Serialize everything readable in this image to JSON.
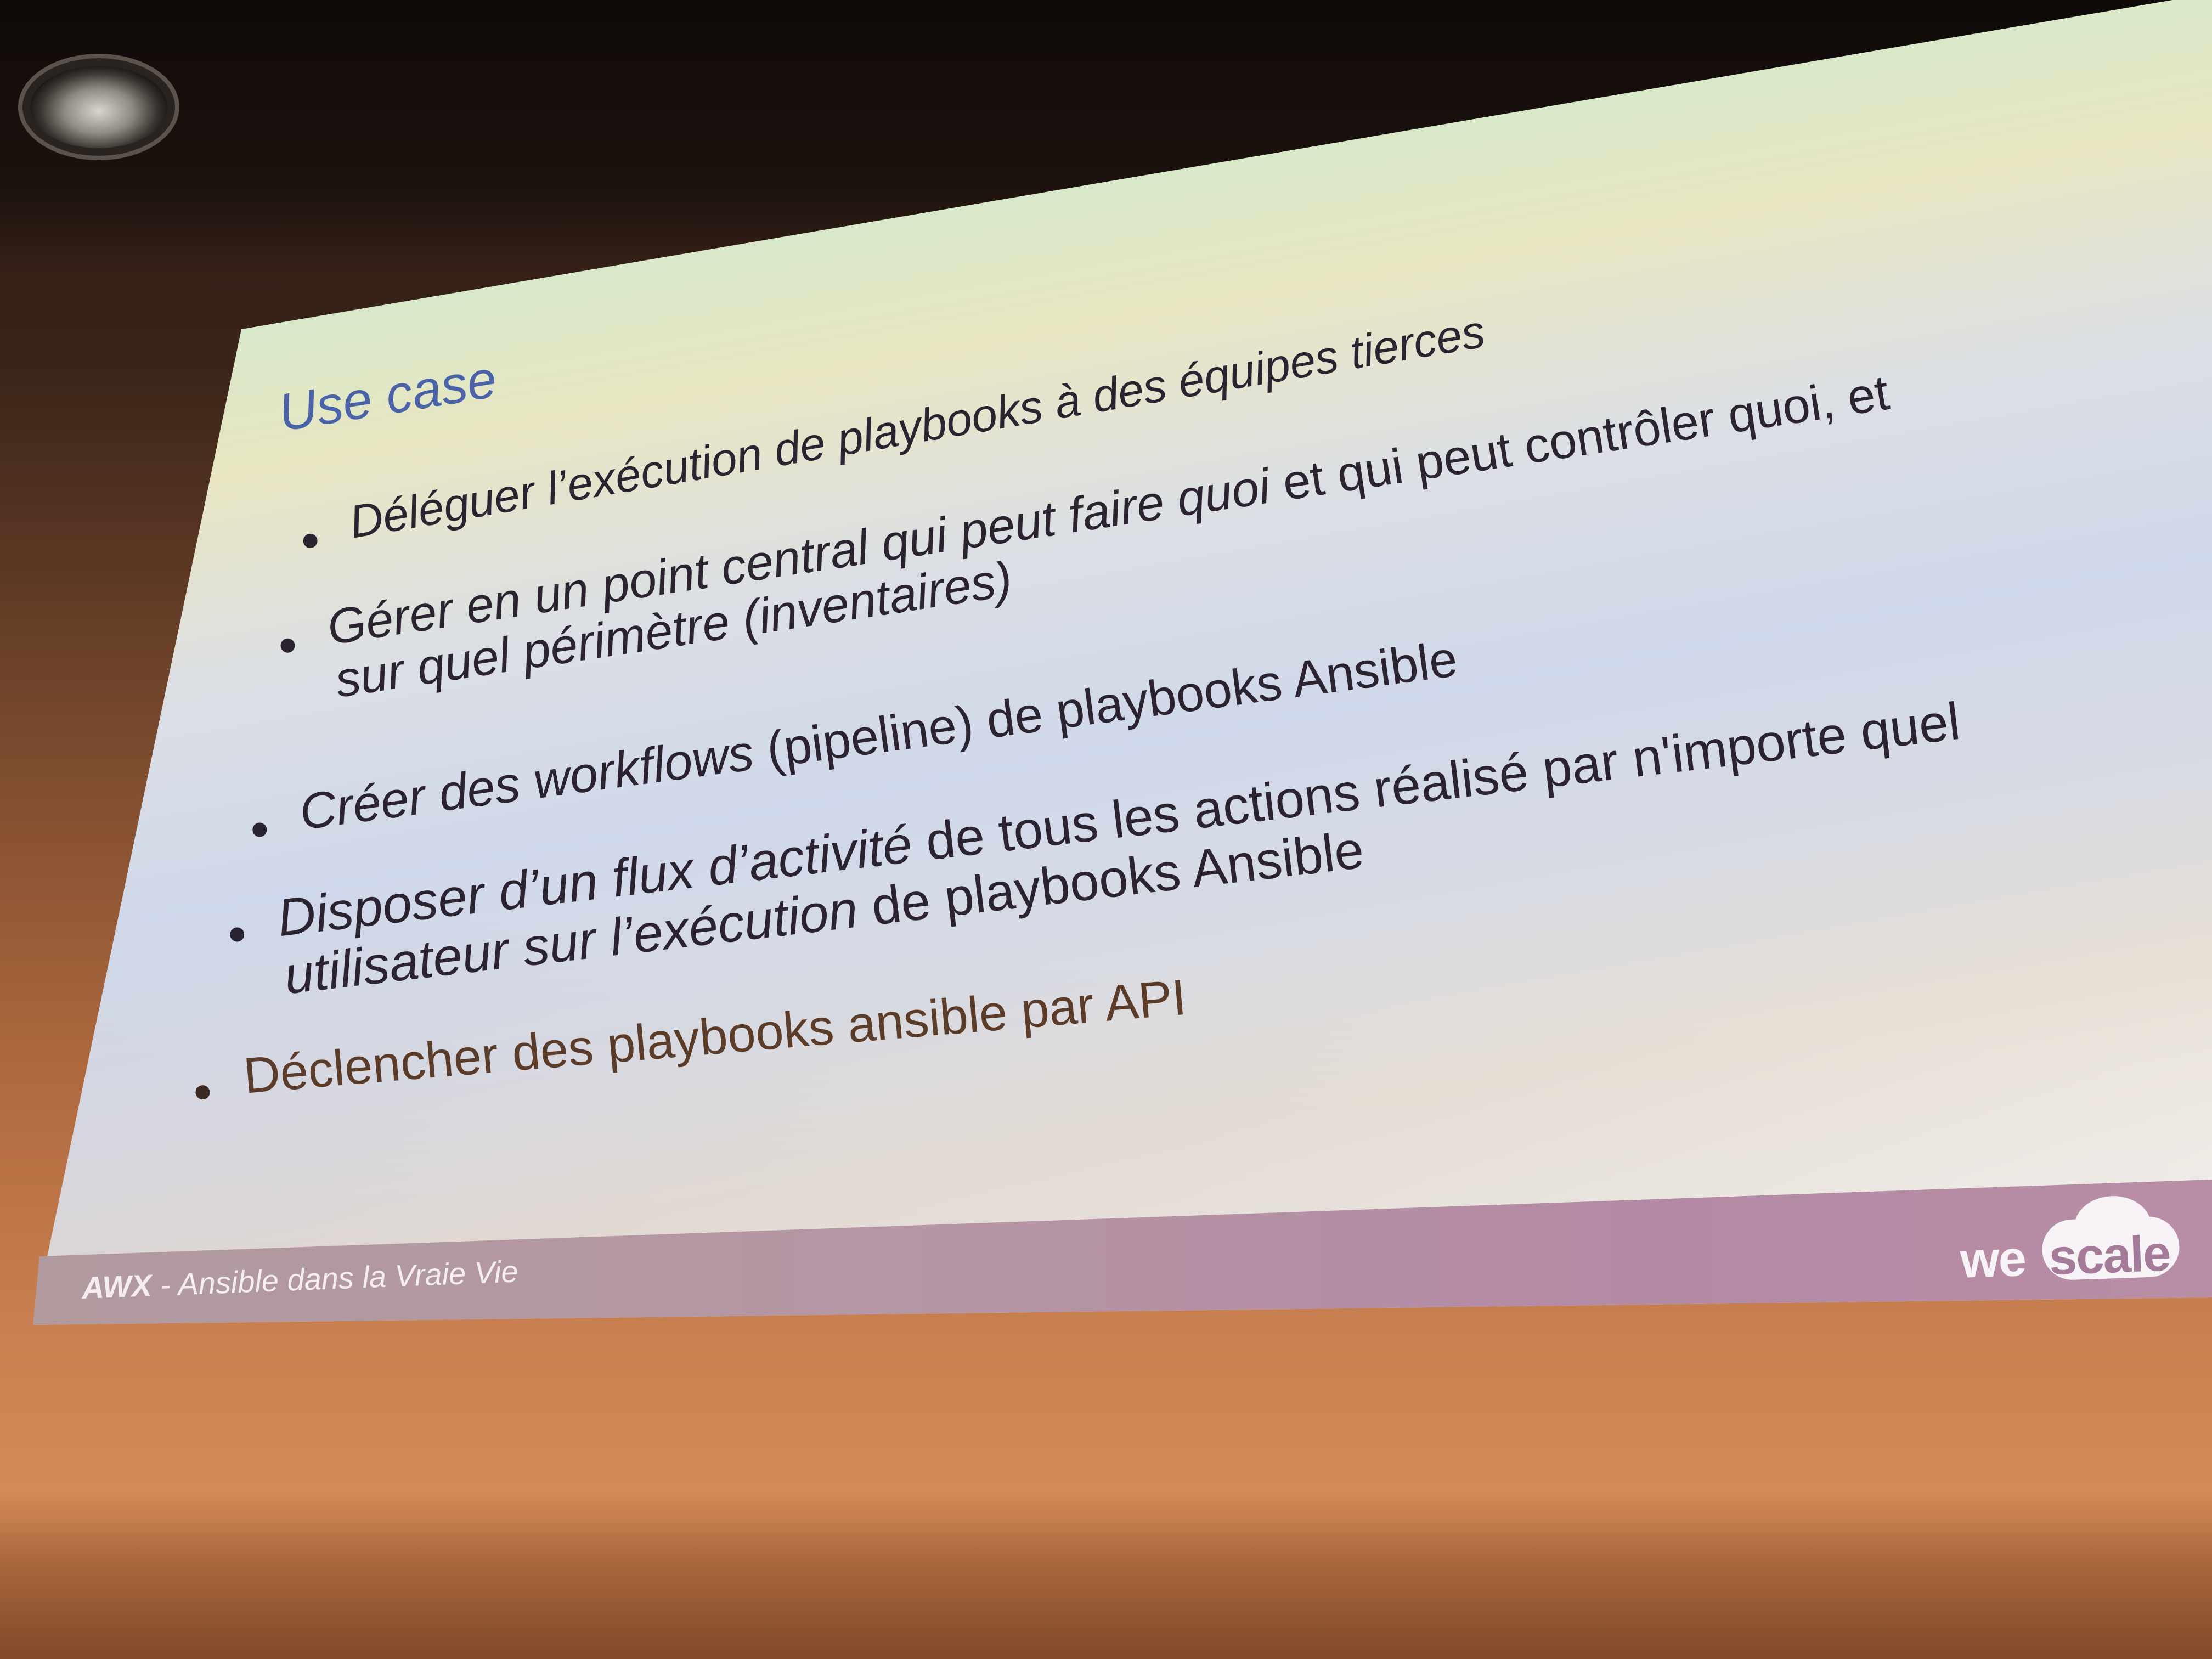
{
  "slide": {
    "title": "Use case",
    "bullets": [
      {
        "line1": "Déléguer l’exécution de playbooks à des équipes tierces"
      },
      {
        "line1a": "Gérer en un point central qui peut faire quoi",
        "line1b": " et qui peut contrôler quoi, et",
        "line2": "sur quel périmètre (inventaires)"
      },
      {
        "part_italic": "Créer des workflows",
        "part_normal": " (pipeline) de playbooks Ansible"
      },
      {
        "line1_italic": "Disposer d’un flux d’activité",
        "line1_normal": " de tous les actions réalisé par n'importe quel",
        "line2_italic": "utilisateur sur l’exécution",
        "line2_normal": " de playbooks Ansible"
      },
      {
        "line1": "Déclencher des playbooks ansible par API"
      }
    ],
    "footer": {
      "brand_bold": "AWX",
      "brand_rest": " - Ansible dans la Vraie Vie",
      "logo_we": "we",
      "logo_scale": "scale"
    }
  }
}
